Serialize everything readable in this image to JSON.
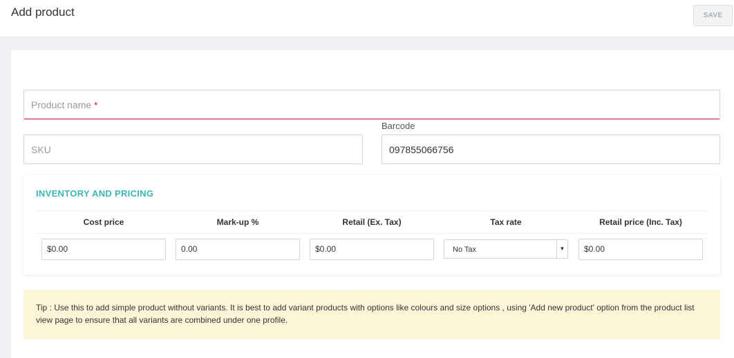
{
  "header": {
    "title": "Add product",
    "save_label": "SAVE"
  },
  "form": {
    "product_name_placeholder": "Product name",
    "required_marker": "*",
    "sku_placeholder": "SKU",
    "barcode_label": "Barcode",
    "barcode_value": "097855066756"
  },
  "inventory": {
    "title": "INVENTORY AND PRICING",
    "columns": [
      "Cost price",
      "Mark-up %",
      "Retail (Ex. Tax)",
      "Tax rate",
      "Retail price (Inc. Tax)"
    ],
    "cost_price": "$0.00",
    "markup": "0.00",
    "retail_ex_tax": "$0.00",
    "tax_rate": "No Tax",
    "retail_inc_tax": "$0.00"
  },
  "tip": "Tip : Use this to add simple product without variants. It is best to add variant products with options like colours and size options , using 'Add new product' option from the product list view page to ensure that all variants are combined under one profile.",
  "icons": {
    "select_arrow": "caret-down-icon"
  },
  "colors": {
    "accent": "#3bb8b0",
    "required": "#d0021b",
    "tip_background": "#fcf6d9"
  }
}
